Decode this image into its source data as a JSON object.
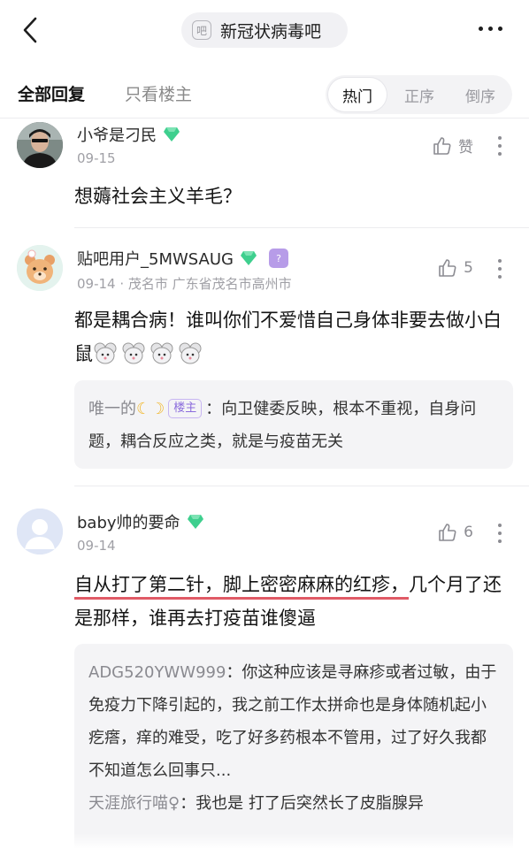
{
  "header": {
    "back_icon": "chevron-left-icon",
    "forum_icon_char": "吧",
    "forum_name": "新冠状病毒吧",
    "more_icon": "more-horizontal-icon"
  },
  "filters": {
    "all_replies": "全部回复",
    "host_only": "只看楼主",
    "sort_options": [
      "热门",
      "正序",
      "倒序"
    ],
    "active_sort": "热门"
  },
  "posts": [
    {
      "username": "小爷是刁民",
      "date": "09-15",
      "location": "",
      "like_label": "赞",
      "content": "想薅社会主义羊毛？"
    },
    {
      "username": "贴吧用户_5MWSAUG",
      "date": "09-14",
      "location": "· 茂名市 广东省茂名市高州市",
      "like_label": "5",
      "content": "都是耦合病！谁叫你们不爱惜自己身体非要去做小白鼠",
      "reply": {
        "name": "唯一的",
        "host_tag": "楼主",
        "text": "：向卫健委反映，根本不重视，自身问题，耦合反应之类，就是与疫苗无关"
      }
    },
    {
      "username": "baby帅的要命",
      "date": "09-14",
      "location": "",
      "like_label": "6",
      "content_marked": "自从打了第二针，脚上密密麻麻的红疹，",
      "content_rest": "几个月了还是那样，谁再去打疫苗谁傻逼",
      "replies": [
        {
          "name": "ADG520YWW999",
          "text": "：你这种应该是寻麻疹或者过敏，由于免疫力下降引起的，我之前工作太拼命也是身体随机起小疙瘩，痒的难受，吃了好多药根本不管用，过了好久我都不知道怎么回事只..."
        },
        {
          "name": "天涯旅行喵♀",
          "text": "：我也是 打了后突然长了皮脂腺异"
        }
      ]
    }
  ],
  "colors": {
    "accent_red": "#e05a66",
    "diamond": "#3ecf8e",
    "host_tag": "#8b6cdc"
  }
}
